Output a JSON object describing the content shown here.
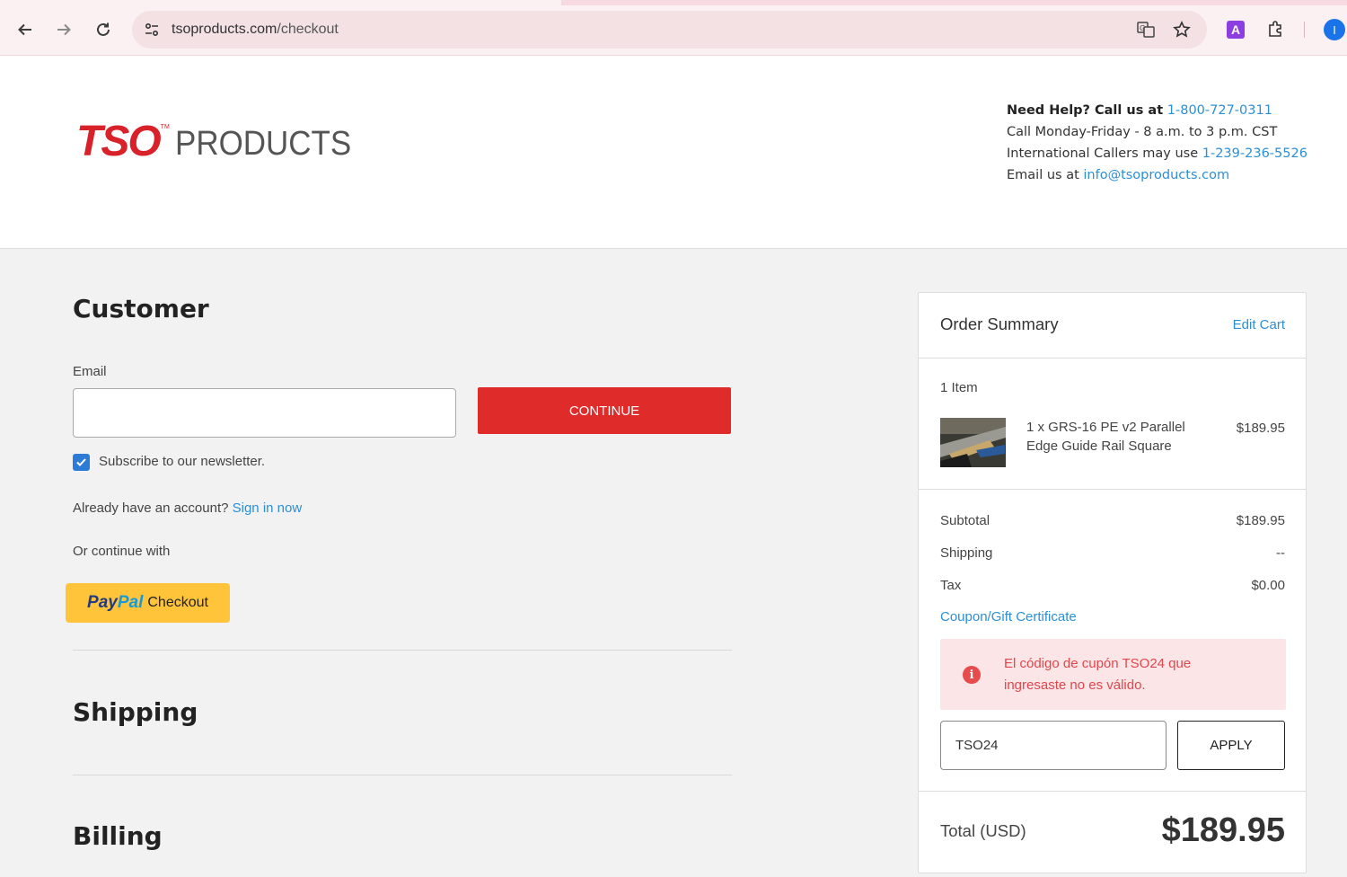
{
  "browser": {
    "url_host": "tsoproducts.com",
    "url_path": "/checkout",
    "profile_initial": "I",
    "extension_label": "A"
  },
  "header": {
    "logo_brand": "TSO",
    "logo_tm": "TM",
    "logo_word": "PRODUCTS",
    "help_bold": "Need Help? Call us at",
    "help_phone": "1-800-727-0311",
    "help_hours": "Call Monday-Friday - 8 a.m. to 3 p.m. CST",
    "intl_text": "International Callers may use",
    "intl_phone": "1-239-236-5526",
    "email_text": "Email us at",
    "email_address": "info@tsoproducts.com"
  },
  "customer": {
    "title": "Customer",
    "email_label": "Email",
    "email_value": "",
    "continue_label": "CONTINUE",
    "newsletter_label": "Subscribe to our newsletter.",
    "newsletter_checked": true,
    "account_text": "Already have an account?",
    "sign_in_label": "Sign in now",
    "or_continue": "Or continue with",
    "paypal_pay": "Pay",
    "paypal_pal": "Pal",
    "paypal_checkout": "Checkout"
  },
  "shipping": {
    "title": "Shipping"
  },
  "billing": {
    "title": "Billing"
  },
  "summary": {
    "title": "Order Summary",
    "edit_cart": "Edit Cart",
    "items_count": "1 Item",
    "product_name": "1 x GRS-16 PE v2 Parallel Edge Guide Rail Square",
    "product_price": "$189.95",
    "subtotal_label": "Subtotal",
    "subtotal_value": "$189.95",
    "shipping_label": "Shipping",
    "shipping_value": "--",
    "tax_label": "Tax",
    "tax_value": "$0.00",
    "coupon_link": "Coupon/Gift Certificate",
    "error_message": "El código de cupón TSO24 que ingresaste no es válido.",
    "coupon_value": "TSO24",
    "apply_label": "APPLY",
    "total_label": "Total (USD)",
    "total_value": "$189.95"
  },
  "colors": {
    "brand_red": "#d82129",
    "continue_red": "#e02b2b",
    "link_blue": "#2d8fd5",
    "paypal_yellow": "#ffc439",
    "error_bg": "#fbe5e6",
    "error_text": "#e0474d"
  }
}
